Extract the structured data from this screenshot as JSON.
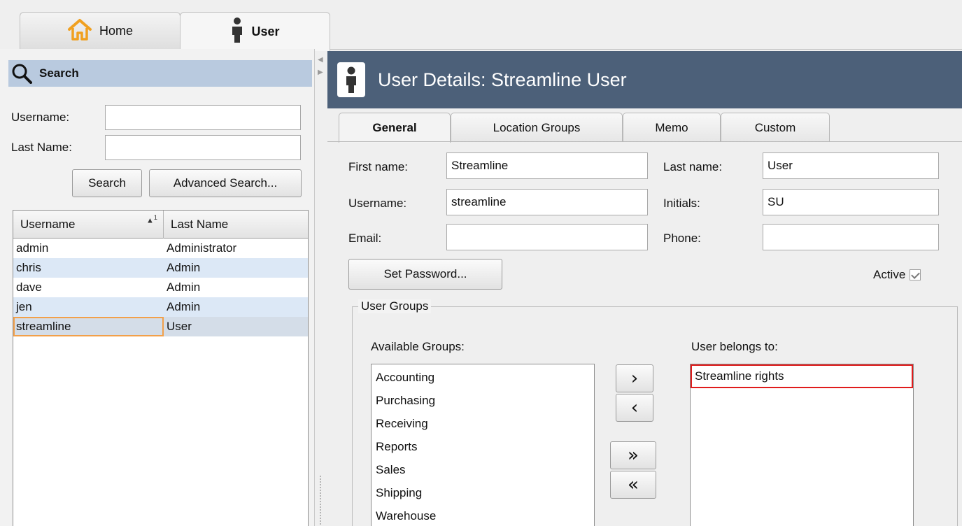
{
  "top_tabs": {
    "home_label": "Home",
    "user_label": "User"
  },
  "search_panel": {
    "header": "Search",
    "username_label": "Username:",
    "username_value": "",
    "lastname_label": "Last Name:",
    "lastname_value": "",
    "search_button": "Search",
    "advanced_button": "Advanced Search...",
    "columns": [
      "Username",
      "Last Name"
    ],
    "sort_indicator": "1",
    "rows": [
      {
        "username": "admin",
        "last_name": "Administrator"
      },
      {
        "username": "chris",
        "last_name": "Admin"
      },
      {
        "username": "dave",
        "last_name": "Admin"
      },
      {
        "username": "jen",
        "last_name": "Admin"
      },
      {
        "username": "streamline",
        "last_name": "User"
      }
    ],
    "selected_row": "streamline"
  },
  "details": {
    "title": "User Details: Streamline User",
    "tabs": [
      "General",
      "Location Groups",
      "Memo",
      "Custom"
    ],
    "active_tab": "General",
    "first_name_label": "First name:",
    "first_name": "Streamline",
    "last_name_label": "Last name:",
    "last_name": "User",
    "username_label": "Username:",
    "username": "streamline",
    "initials_label": "Initials:",
    "initials": "SU",
    "email_label": "Email:",
    "email": "",
    "phone_label": "Phone:",
    "phone": "",
    "set_password_button": "Set Password...",
    "active_label": "Active",
    "active_checked": true
  },
  "user_groups": {
    "legend": "User Groups",
    "available_label": "Available Groups:",
    "available": [
      "Accounting",
      "Purchasing",
      "Receiving",
      "Reports",
      "Sales",
      "Shipping",
      "Warehouse"
    ],
    "belongs_label": "User belongs to:",
    "belongs": [
      "Streamline rights"
    ],
    "move_right": "›",
    "move_left": "‹",
    "move_all_right": "»",
    "move_all_left": "«"
  },
  "colors": {
    "header_bg": "#4c6079",
    "search_header_bg": "#b9cadf",
    "row_alt": "#dce8f6",
    "selection_outline": "#f2a04a",
    "highlight_border": "#e01c1c",
    "home_icon": "#f0a020"
  },
  "icons": [
    "home-icon",
    "user-icon",
    "search-icon",
    "collapse-arrow-icon",
    "sort-ascending-icon",
    "checkbox-checked-icon"
  ]
}
